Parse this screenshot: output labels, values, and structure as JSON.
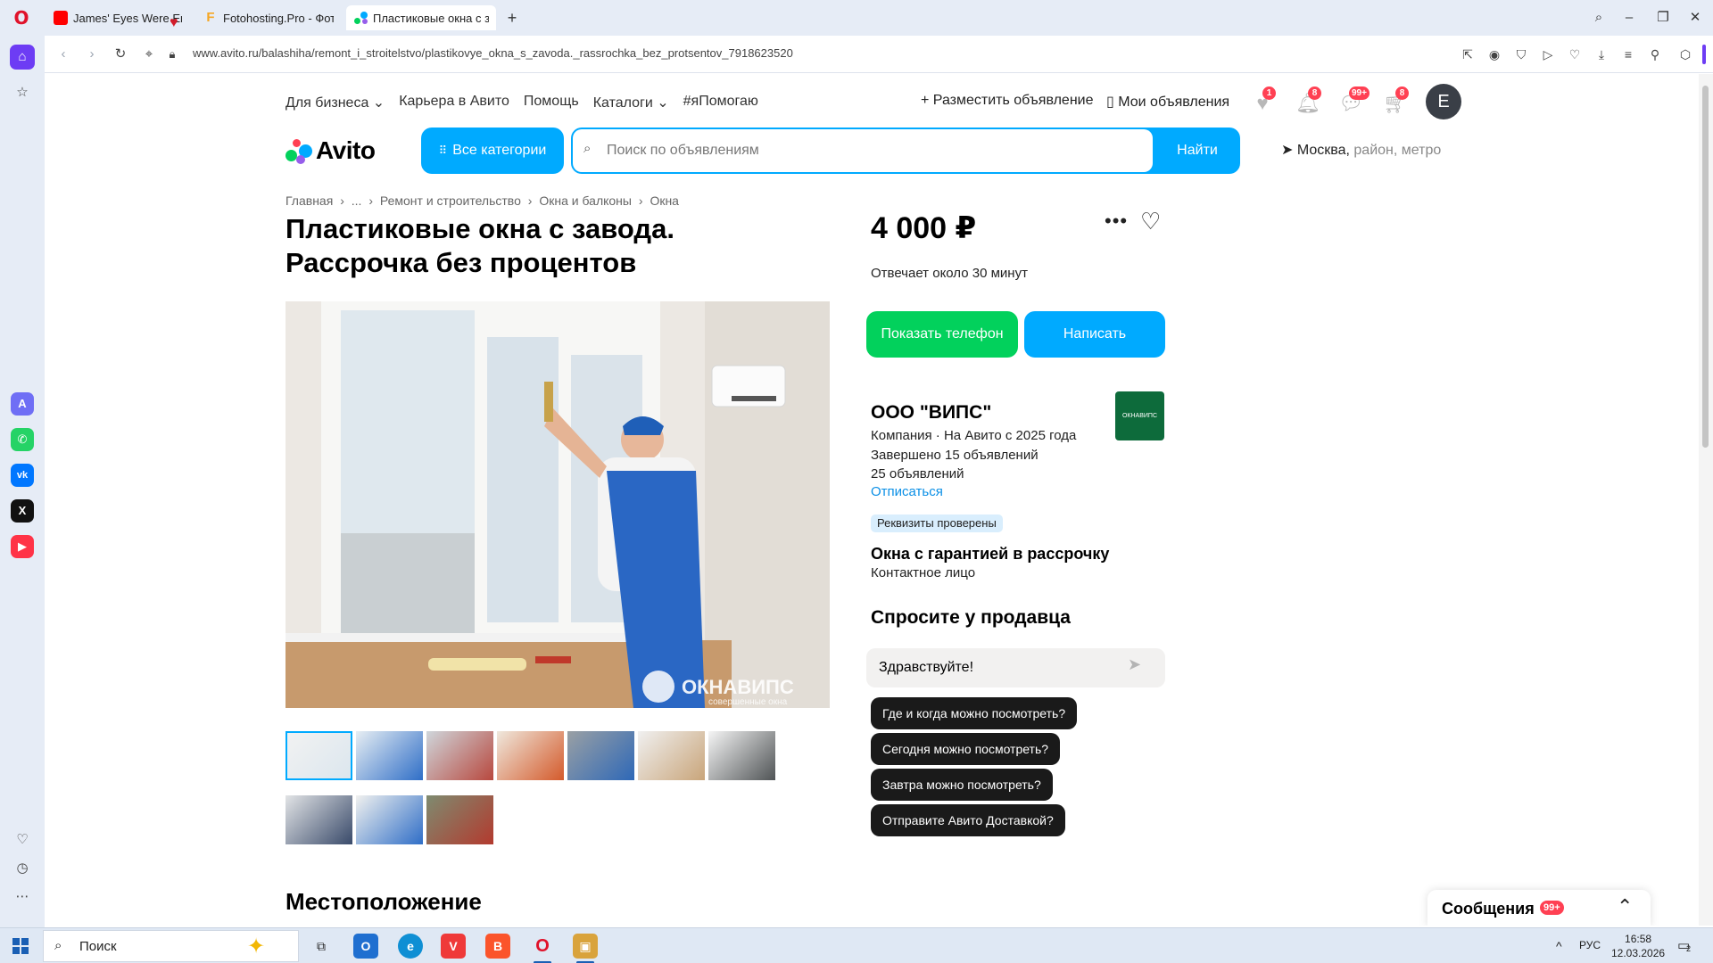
{
  "browser": {
    "tabs": [
      {
        "title": "James' Eyes Were Empty",
        "fav_color": "#ff0000"
      },
      {
        "title": "Fotohosting.Pro - Фотохо",
        "fav_color": "#f5a623"
      },
      {
        "title": "Пластиковые окна с заво",
        "fav_color": "#00aaff"
      }
    ],
    "url": "www.avito.ru/balashiha/remont_i_stroitelstvo/plastikovye_okna_s_zavoda._rassrochka_bez_protsentov_7918623520"
  },
  "header": {
    "links": [
      "Для бизнеса ⌄",
      "Карьера в Авито",
      "Помощь",
      "Каталоги ⌄",
      "#яПомогаю"
    ],
    "post_ad": "Разместить объявление",
    "my_ads": "Мои объявления",
    "badges": {
      "favorites": "1",
      "notifications": "8",
      "messages": "99+",
      "cart": "8"
    },
    "avatar_letter": "E",
    "logo_text": "Avito",
    "all_categories": "Все категории",
    "search_placeholder": "Поиск по объявлениям",
    "search_button": "Найти",
    "location_city": "Москва,",
    "location_sub": "район, метро"
  },
  "breadcrumb": [
    "Главная",
    "›",
    "...",
    "›",
    "Ремонт и строительство",
    "›",
    "Окна и балконы",
    "›",
    "Окна"
  ],
  "listing": {
    "title": "Пластиковые окна с завода. Рассрочка без процентов",
    "price": "4 000 ₽",
    "reply_time": "Отвечает около 30 минут",
    "photo_watermark": "ОКНАВИПС",
    "photo_watermark_sub": "совершенные окна",
    "thumbnail_count": 10
  },
  "actions": {
    "show_phone": "Показать телефон",
    "write": "Написать"
  },
  "seller": {
    "name": "ООО \"ВИПС\"",
    "line1": "Компания · На Авито с 2025 года",
    "line2": "Завершено 15 объявлений",
    "line3": "25 объявлений",
    "unsubscribe": "Отписаться",
    "verified": "Реквизиты проверены",
    "shop_name": "Окна с гарантией в рассрочку",
    "contact": "Контактное лицо",
    "logo_text": "ОКНАВИПС"
  },
  "ask": {
    "title": "Спросите у продавца",
    "input_value": "Здравствуйте!",
    "chips": [
      "Где и когда можно посмотреть?",
      "Сегодня можно посмотреть?",
      "Завтра можно посмотреть?",
      "Отправите Авито Доставкой?"
    ]
  },
  "location_title": "Местоположение",
  "messages_panel": {
    "title": "Сообщения",
    "badge": "99+"
  },
  "taskbar": {
    "search_text": "Поиск",
    "lang": "РУС",
    "time": "16:58",
    "date": "12.03.2026",
    "notif_count": "2"
  },
  "colors": {
    "avito_blue": "#00aaff",
    "avito_green": "#02d15c",
    "badge_red": "#ff4053",
    "opera_purple": "#6d3cf4"
  }
}
